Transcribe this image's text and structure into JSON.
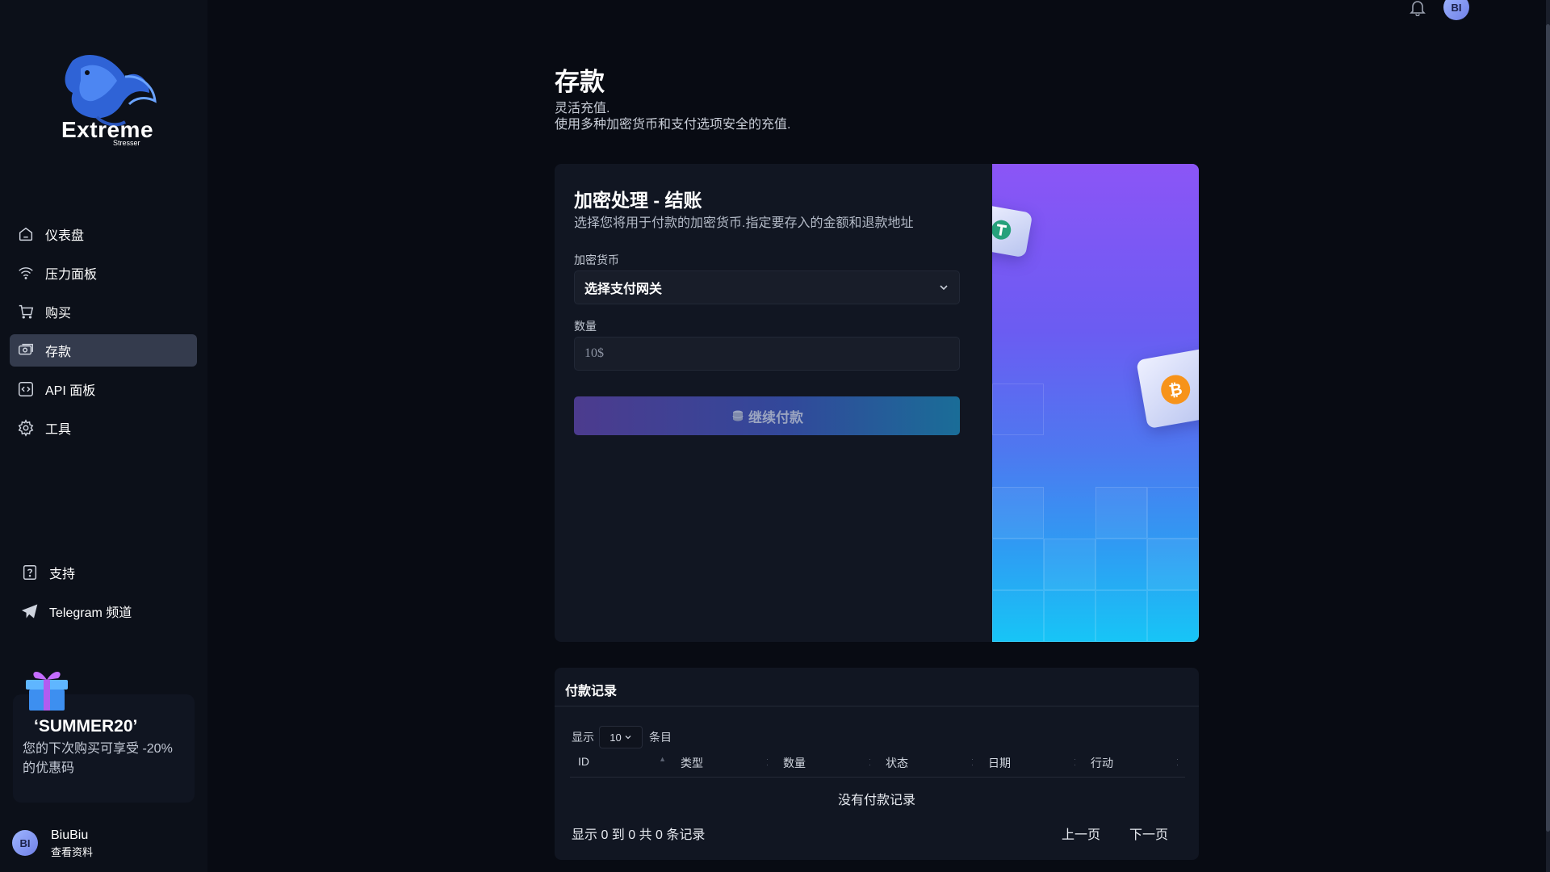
{
  "brand": {
    "name": "Extreme",
    "sub": "Stresser"
  },
  "sidebar": {
    "items": [
      {
        "label": "仪表盘",
        "icon": "home-icon"
      },
      {
        "label": "压力面板",
        "icon": "wifi-icon"
      },
      {
        "label": "购买",
        "icon": "cart-icon"
      },
      {
        "label": "存款",
        "icon": "deposit-icon",
        "active": true
      },
      {
        "label": "API 面板",
        "icon": "api-icon"
      },
      {
        "label": "工具",
        "icon": "gear-icon"
      }
    ],
    "bottom_items": [
      {
        "label": "支持",
        "icon": "help-icon"
      },
      {
        "label": "Telegram 频道",
        "icon": "telegram-icon"
      }
    ]
  },
  "promo": {
    "code": "‘SUMMER20’",
    "description": "您的下次购买可享受 -20% 的优惠码"
  },
  "user": {
    "initials": "BI",
    "name": "BiuBiu",
    "profile_link": "查看资料"
  },
  "header": {
    "avatar_initials": "BI"
  },
  "page": {
    "title": "存款",
    "subtitle_line1": "灵活充值.",
    "subtitle_line2": "使用多种加密货币和支付选项安全的充值."
  },
  "checkout": {
    "title": "加密处理 - 结账",
    "subtitle": "选择您将用于付款的加密货币.指定要存入的金额和退款地址",
    "currency_label": "加密货币",
    "currency_value": "选择支付网关",
    "amount_label": "数量",
    "amount_placeholder": "10$",
    "submit_label": "继续付款"
  },
  "history": {
    "title": "付款记录",
    "show_label": "显示",
    "page_size": "10",
    "entries_label": "条目",
    "columns": [
      "ID",
      "类型",
      "数量",
      "状态",
      "日期",
      "行动"
    ],
    "empty_text": "没有付款记录",
    "info_text": "显示 0 到 0 共 0 条记录",
    "prev_label": "上一页",
    "next_label": "下一页"
  },
  "colors": {
    "background": "#080b13",
    "sidebar": "#0c1019",
    "card": "#111622",
    "active_nav": "#343b4d"
  }
}
